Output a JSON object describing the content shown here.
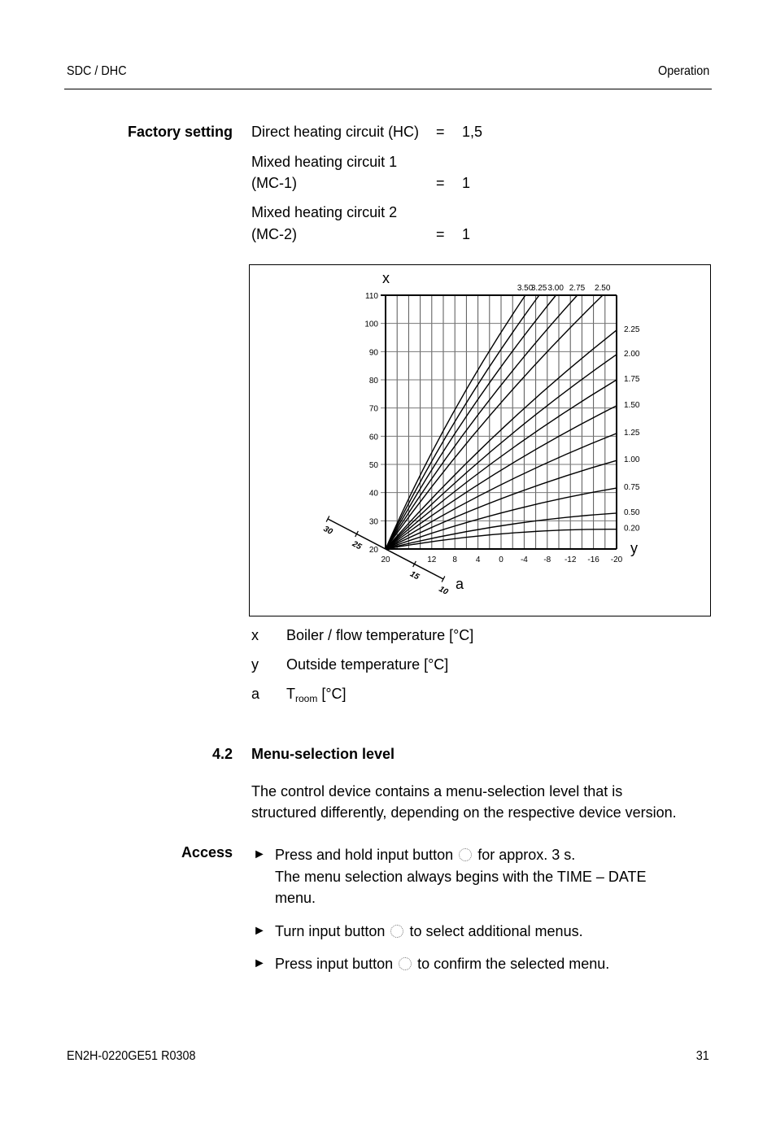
{
  "header": {
    "left": "SDC / DHC",
    "right": "Operation"
  },
  "factory_setting": {
    "label": "Factory setting",
    "rows": [
      {
        "name_lines": [
          "Direct heating circuit (HC)"
        ],
        "eq": "=",
        "value": "1,5"
      },
      {
        "name_lines": [
          "Mixed heating circuit 1",
          "(MC-1)"
        ],
        "eq": "=",
        "value": "1"
      },
      {
        "name_lines": [
          "Mixed heating circuit 2",
          "(MC-2)"
        ],
        "eq": "=",
        "value": "1"
      }
    ]
  },
  "chart_data": {
    "type": "line",
    "title": "",
    "xlabel": "y",
    "ylabel": "x",
    "diag_axis_label": "a",
    "xlim": [
      20,
      -20
    ],
    "ylim": [
      20,
      110
    ],
    "x_ticks": [
      20,
      12,
      8,
      4,
      0,
      -4,
      -8,
      -12,
      -16,
      -20
    ],
    "x_tick_labels": [
      "20",
      "12",
      "8",
      "4",
      "0",
      "-4",
      "-8",
      "-12",
      "-16",
      "-20"
    ],
    "x_grid_step": 2,
    "y_ticks": [
      20,
      30,
      40,
      50,
      60,
      70,
      80,
      90,
      100,
      110
    ],
    "y_tick_labels": [
      "20",
      "30",
      "40",
      "50",
      "60",
      "70",
      "80",
      "90",
      "100",
      "110"
    ],
    "diag_ticks": [
      30,
      25,
      20,
      15,
      10
    ],
    "diag_tick_labels": [
      "30",
      "25",
      "20",
      "15",
      "10"
    ],
    "grid": true,
    "origin": {
      "outside": 20,
      "flow": 20
    },
    "series": [
      {
        "name": "0.20",
        "label_pos": "right",
        "end": {
          "outside": -20,
          "flow": 27
        }
      },
      {
        "name": "0.50",
        "label_pos": "right",
        "end": {
          "outside": -20,
          "flow": 32.7
        }
      },
      {
        "name": "0.75",
        "label_pos": "right",
        "end": {
          "outside": -20,
          "flow": 41.6
        }
      },
      {
        "name": "1.00",
        "label_pos": "right",
        "end": {
          "outside": -20,
          "flow": 51.4
        }
      },
      {
        "name": "1.25",
        "label_pos": "right",
        "end": {
          "outside": -20,
          "flow": 61
        }
      },
      {
        "name": "1.50",
        "label_pos": "right",
        "end": {
          "outside": -20,
          "flow": 70.8
        }
      },
      {
        "name": "1.75",
        "label_pos": "right",
        "end": {
          "outside": -20,
          "flow": 80
        }
      },
      {
        "name": "2.00",
        "label_pos": "right",
        "end": {
          "outside": -20,
          "flow": 89
        }
      },
      {
        "name": "2.25",
        "label_pos": "right",
        "end": {
          "outside": -20,
          "flow": 97.6
        }
      },
      {
        "name": "2.50",
        "label_pos": "top",
        "end": {
          "outside": -17.6,
          "flow": 110
        }
      },
      {
        "name": "2.75",
        "label_pos": "top",
        "end": {
          "outside": -13.2,
          "flow": 110
        }
      },
      {
        "name": "3.00",
        "label_pos": "top",
        "end": {
          "outside": -9.5,
          "flow": 110
        }
      },
      {
        "name": "3.25",
        "label_pos": "top",
        "end": {
          "outside": -6.6,
          "flow": 110
        }
      },
      {
        "name": "3.50",
        "label_pos": "top",
        "end": {
          "outside": -4.2,
          "flow": 110
        }
      }
    ]
  },
  "legend": [
    {
      "key": "x",
      "text": "Boiler / flow temperature [°C]"
    },
    {
      "key": "y",
      "text": "Outside temperature [°C]"
    },
    {
      "key": "a",
      "text_main": "T",
      "text_sub": "room",
      "text_tail": " [°C]"
    }
  ],
  "section": {
    "number": "4.2",
    "title": "Menu-selection level",
    "intro_lines": [
      "The control device contains a menu-selection level that is",
      "structured differently, depending on the respective device version."
    ]
  },
  "access": {
    "label": "Access",
    "bullet_glyph": "►",
    "button_icon": "dial-button-icon",
    "steps": [
      {
        "pre": "Press and hold input button",
        "post": "for approx. 3 s.",
        "extra_lines": [
          "The menu selection always begins with the TIME – DATE",
          "menu."
        ]
      },
      {
        "pre": "Turn input button",
        "post": "to select additional menus.",
        "extra_lines": []
      },
      {
        "pre": "Press input button",
        "post": "to confirm the selected menu.",
        "extra_lines": []
      }
    ]
  },
  "footer": {
    "left": "EN2H-0220GE51 R0308",
    "right": "31"
  }
}
